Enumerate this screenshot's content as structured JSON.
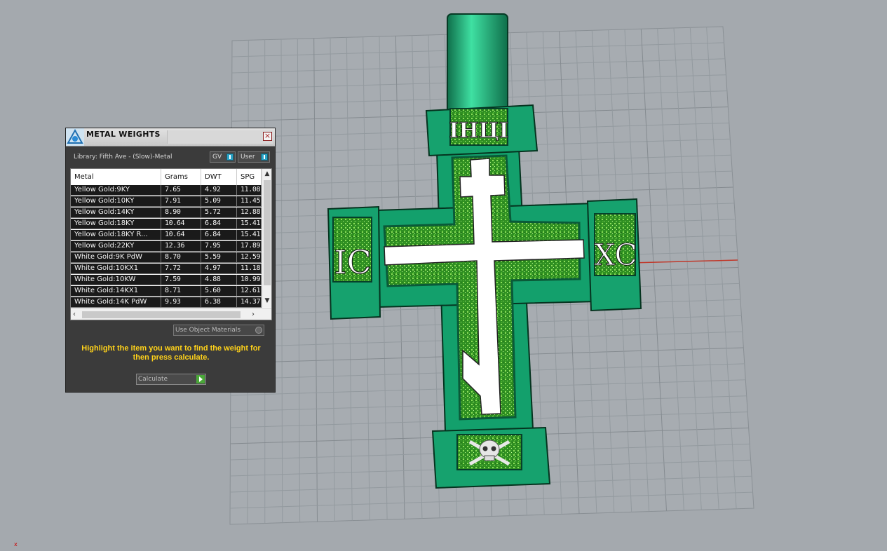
{
  "panel": {
    "title": "METAL WEIGHTS",
    "close_label": "×",
    "library_label": "Library: Fifth Ave - (Slow)-Metal",
    "toggles": {
      "gv": "GV",
      "user": "User"
    },
    "columns": [
      "Metal",
      "Grams",
      "DWT",
      "SPG"
    ],
    "rows": [
      {
        "metal": "Yellow Gold:9KY",
        "grams": "7.65",
        "dwt": "4.92",
        "spg": "11.08"
      },
      {
        "metal": "Yellow Gold:10KY",
        "grams": "7.91",
        "dwt": "5.09",
        "spg": "11.45"
      },
      {
        "metal": "Yellow Gold:14KY",
        "grams": "8.90",
        "dwt": "5.72",
        "spg": "12.88"
      },
      {
        "metal": "Yellow Gold:18KY",
        "grams": "10.64",
        "dwt": "6.84",
        "spg": "15.41"
      },
      {
        "metal": "Yellow Gold:18KY R...",
        "grams": "10.64",
        "dwt": "6.84",
        "spg": "15.41"
      },
      {
        "metal": "Yellow Gold:22KY",
        "grams": "12.36",
        "dwt": "7.95",
        "spg": "17.89"
      },
      {
        "metal": "White Gold:9K PdW",
        "grams": "8.70",
        "dwt": "5.59",
        "spg": "12.59"
      },
      {
        "metal": "White Gold:10KX1",
        "grams": "7.72",
        "dwt": "4.97",
        "spg": "11.18"
      },
      {
        "metal": "White Gold:10KW",
        "grams": "7.59",
        "dwt": "4.88",
        "spg": "10.99"
      },
      {
        "metal": "White Gold:14KX1",
        "grams": "8.71",
        "dwt": "5.60",
        "spg": "12.61"
      },
      {
        "metal": "White Gold:14K PdW",
        "grams": "9.93",
        "dwt": "6.38",
        "spg": "14.37"
      }
    ],
    "use_object_materials": "Use Object Materials",
    "instruction": "Highlight the item you want to find the weight for then press calculate.",
    "calculate_label": "Calculate"
  },
  "model": {
    "top_plaque": "IHЦI",
    "left_plaque": "IC",
    "right_plaque": "XC",
    "bottom_plaque": "skull-and-crossbones-icon"
  },
  "colors": {
    "viewport_bg": "#a4a9ae",
    "grid_line": "#8f959a",
    "model_green": "#169a6a",
    "glitter": "#3fae2a",
    "axis_x": "#c0392b",
    "instruction": "#ffd21a"
  },
  "axis_marker": "x"
}
